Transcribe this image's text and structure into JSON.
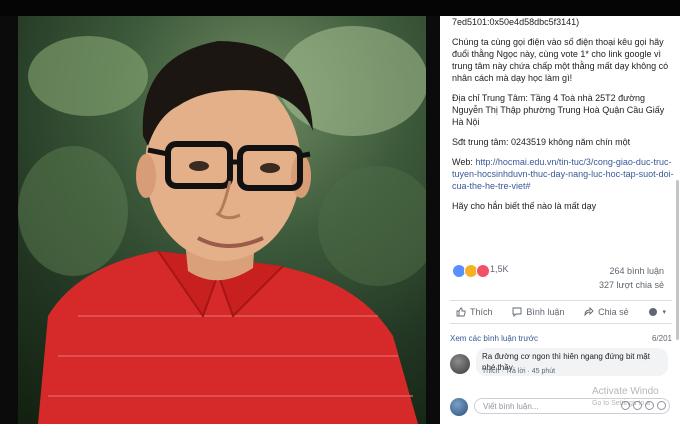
{
  "post": {
    "paragraphs": [
      "7ed5101:0x50e4d58dbc5f3141)",
      "Chúng ta cùng gọi điện vào số điện thoại kêu gọi hãy đuổi thằng Ngọc này, cùng vote 1* cho link google vì trung tâm này chứa chấp một thằng mất dạy không có nhân cách mà dạy học làm gì!",
      "Địa chỉ Trung Tâm: Tầng 4 Toà nhà 25T2 đường Nguyễn Thị Thập phường Trung Hoà Quận Cầu Giấy Hà Nội",
      "Sđt trung tâm: 0243519 không năm chín một"
    ],
    "web_label": "Web: ",
    "web_link": "http://hocmai.edu.vn/tin-tuc/3/cong-giao-duc-truc-tuyen-hocsinhduvn-thuc-day-nang-luc-hoc-tap-suot-doi-cua-the-he-tre-viet#",
    "closing": "Hãy cho hắn biết thế nào là mất dạy"
  },
  "reactions": {
    "count": "1,5K",
    "comments": "264 bình luận",
    "shares": "327 lượt chia sẻ",
    "colors": [
      "#5890ff",
      "#f7b125",
      "#f25268"
    ]
  },
  "actions": {
    "like": "Thích",
    "comment": "Bình luận",
    "share": "Chia sẻ",
    "audience_icon": "globe-icon"
  },
  "comments": {
    "view_previous": "Xem các bình luận trước",
    "count": "6/201",
    "first": {
      "text": "Ra đường cơ ngon thì hiên ngang đứng bit mặt nhé thầy",
      "like": "Thích",
      "reply": "Trả lời",
      "time": "45 phút"
    },
    "write_placeholder": "Viết bình luận..."
  },
  "watermark": {
    "title": "Activate Windo",
    "sub": "Go to Settings to a"
  }
}
